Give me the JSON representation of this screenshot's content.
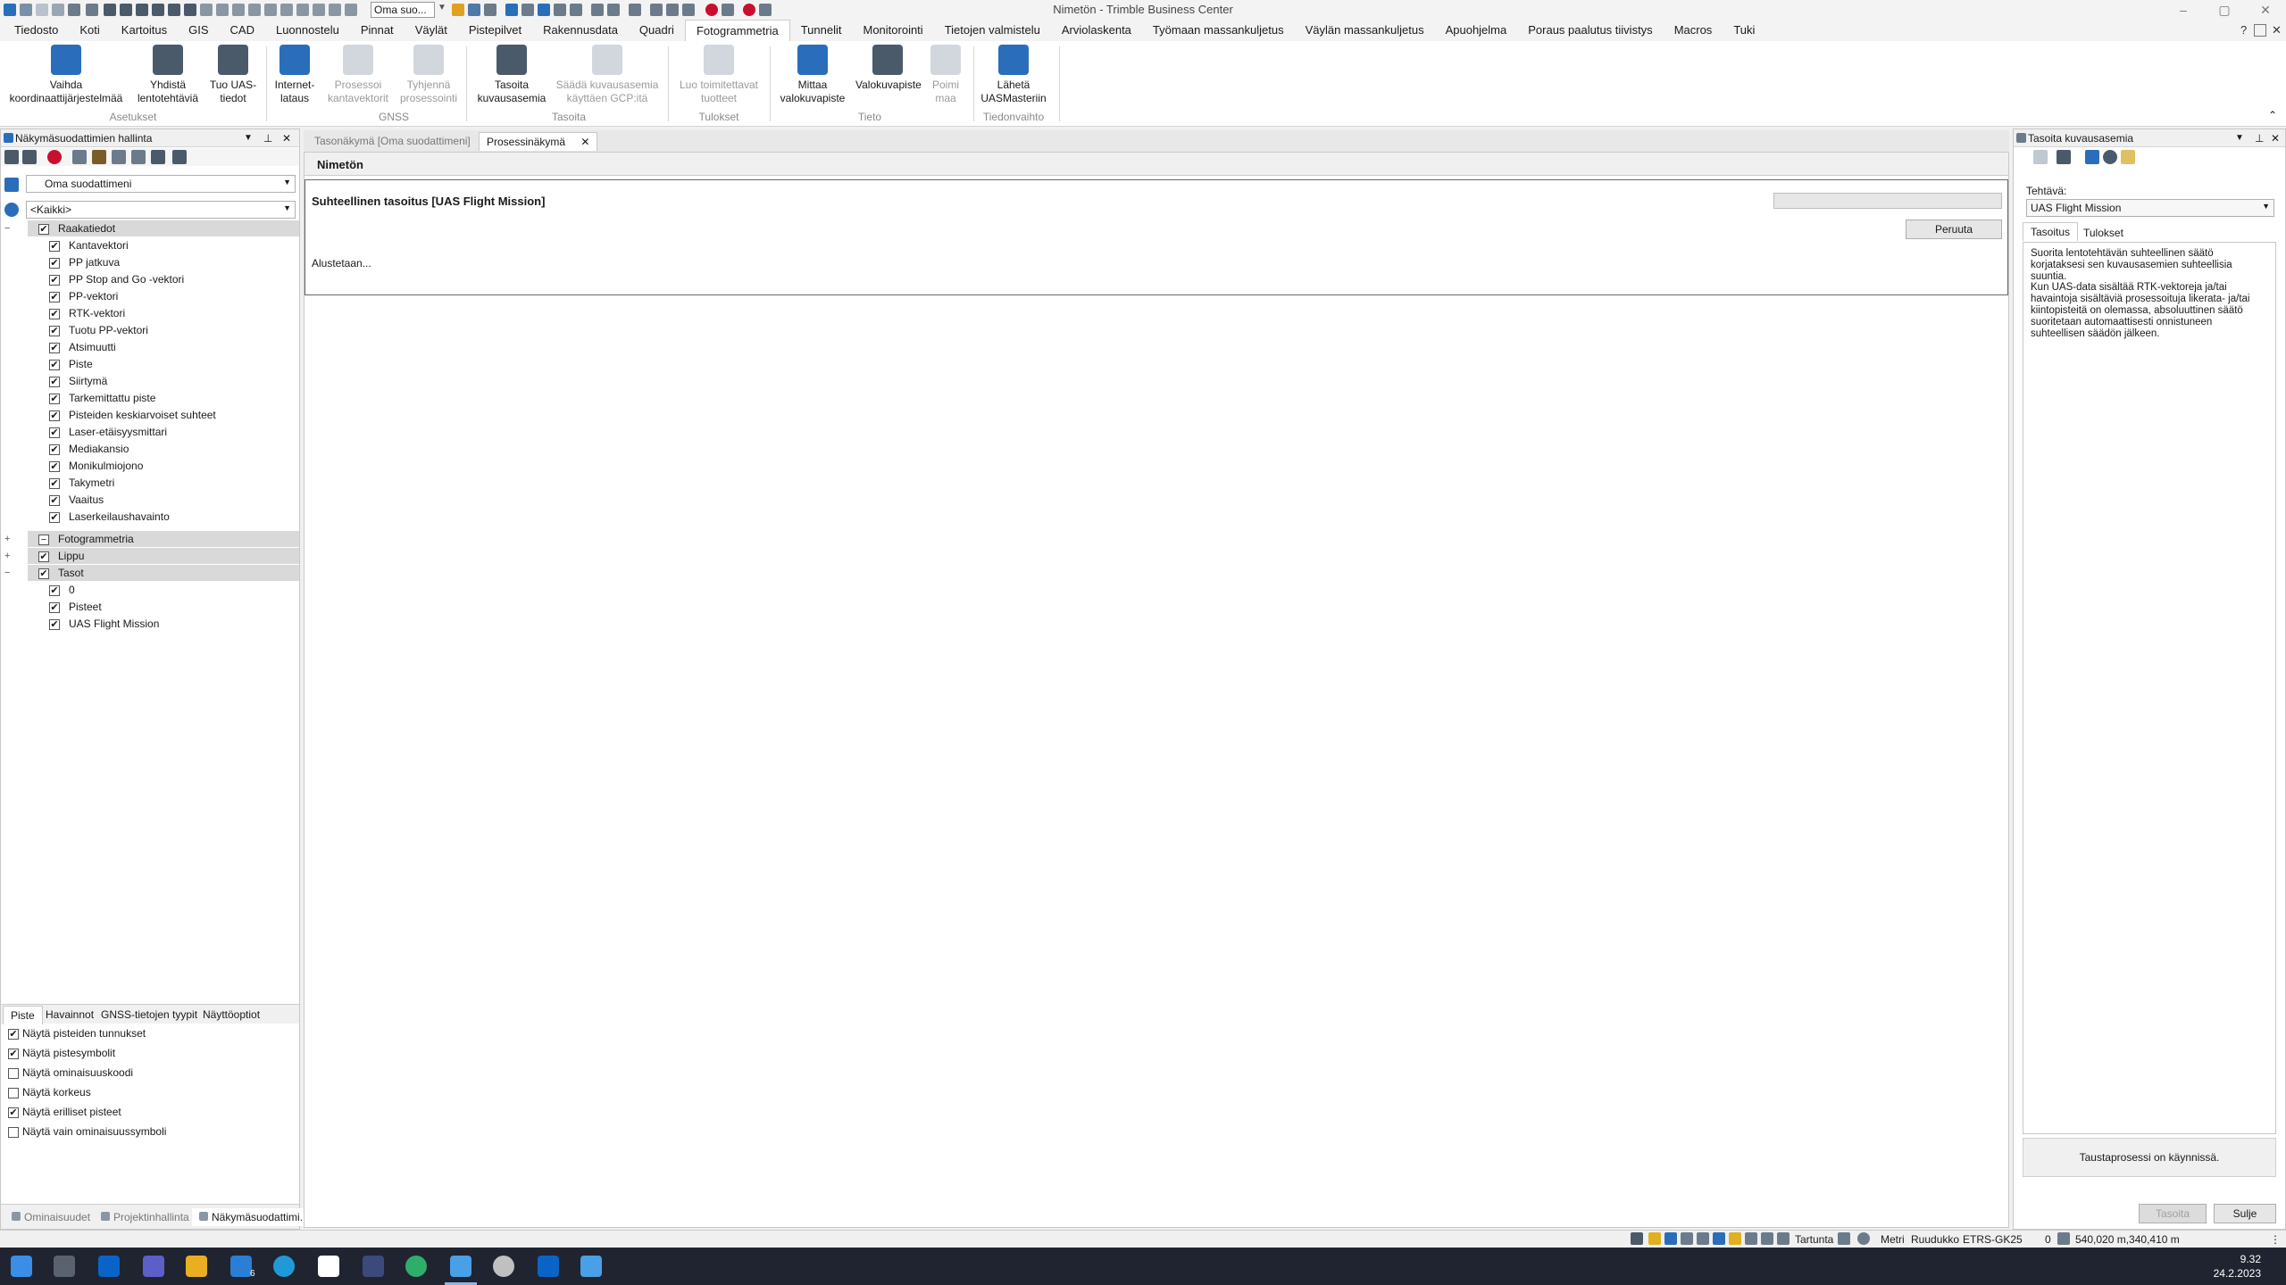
{
  "window": {
    "title": "Nimetön - Trimble Business Center"
  },
  "quick_access": {
    "filter_value": "Oma suo..."
  },
  "menu": [
    {
      "label": "Tiedosto"
    },
    {
      "label": "Koti"
    },
    {
      "label": "Kartoitus"
    },
    {
      "label": "GIS"
    },
    {
      "label": "CAD"
    },
    {
      "label": "Luonnostelu"
    },
    {
      "label": "Pinnat"
    },
    {
      "label": "Väylät"
    },
    {
      "label": "Pistepilvet"
    },
    {
      "label": "Rakennusdata"
    },
    {
      "label": "Quadri"
    },
    {
      "label": "Fotogrammetria"
    },
    {
      "label": "Tunnelit"
    },
    {
      "label": "Monitorointi"
    },
    {
      "label": "Tietojen valmistelu"
    },
    {
      "label": "Arviolaskenta"
    },
    {
      "label": "Työmaan massankuljetus"
    },
    {
      "label": "Väylän massankuljetus"
    },
    {
      "label": "Apuohjelma"
    },
    {
      "label": "Poraus paalutus tiivistys"
    },
    {
      "label": "Macros"
    },
    {
      "label": "Tuki"
    }
  ],
  "menu_help": "?",
  "ribbon": {
    "buttons": [
      {
        "label1": "Vaihda",
        "label2": "koordinaattijärjestelmää",
        "enabled": true,
        "icon": "globe-icon"
      },
      {
        "label1": "Yhdistä",
        "label2": "lentotehtäviä",
        "enabled": true,
        "icon": "drone-merge-icon"
      },
      {
        "label1": "Tuo UAS-",
        "label2": "tiedot",
        "enabled": true,
        "icon": "drone-import-icon"
      },
      {
        "label1": "Internet-",
        "label2": "lataus",
        "enabled": true,
        "icon": "cloud-download-icon"
      },
      {
        "label1": "Prosessoi",
        "label2": "kantavektorit",
        "enabled": false,
        "icon": "vector-process-icon"
      },
      {
        "label1": "Tyhjennä",
        "label2": "prosessointi",
        "enabled": false,
        "icon": "vector-clear-icon"
      },
      {
        "label1": "Tasoita",
        "label2": "kuvausasemia",
        "enabled": true,
        "icon": "network-adjust-icon"
      },
      {
        "label1": "Säädä kuvausasemia",
        "label2": "käyttäen GCP:itä",
        "enabled": false,
        "icon": "gcp-adjust-icon"
      },
      {
        "label1": "Luo toimitettavat",
        "label2": "tuotteet",
        "enabled": false,
        "icon": "deliverables-icon"
      },
      {
        "label1": "Mittaa",
        "label2": "valokuvapiste",
        "enabled": true,
        "icon": "measure-photo-point-icon"
      },
      {
        "label1": "Valokuvapiste",
        "label2": "",
        "enabled": true,
        "icon": "photo-point-icon"
      },
      {
        "label1": "Poimi",
        "label2": "maa",
        "enabled": false,
        "icon": "extract-ground-icon"
      },
      {
        "label1": "Lähetä",
        "label2": "UASMasteriin",
        "enabled": true,
        "icon": "send-uasmaster-icon"
      }
    ],
    "groups": [
      "Asetukset",
      "GNSS",
      "Tasoita",
      "Tulokset",
      "Tieto",
      "Tiedonvaihto"
    ]
  },
  "left_panel": {
    "title": "Näkymäsuodattimien hallinta",
    "filter_value": "Oma suodattimeni",
    "scope_value": "<Kaikki>",
    "tree": [
      {
        "label": "Raakatiedot",
        "group": true,
        "expander": "−",
        "check": "✔"
      },
      {
        "label": "Kantavektori",
        "check": "✔"
      },
      {
        "label": "PP jatkuva",
        "check": "✔"
      },
      {
        "label": "PP Stop and Go -vektori",
        "check": "✔"
      },
      {
        "label": "PP-vektori",
        "check": "✔"
      },
      {
        "label": "RTK-vektori",
        "check": "✔"
      },
      {
        "label": "Tuotu PP-vektori",
        "check": "✔"
      },
      {
        "label": "Atsimuutti",
        "check": "✔"
      },
      {
        "label": "Piste",
        "check": "✔"
      },
      {
        "label": "Siirtymä",
        "check": "✔"
      },
      {
        "label": "Tarkemittattu piste",
        "check": "✔"
      },
      {
        "label": "Pisteiden keskiarvoiset suhteet",
        "check": "✔"
      },
      {
        "label": "Laser-etäisyysmittari",
        "check": "✔"
      },
      {
        "label": "Mediakansio",
        "check": "✔"
      },
      {
        "label": "Monikulmiojono",
        "check": "✔"
      },
      {
        "label": "Takymetri",
        "check": "✔"
      },
      {
        "label": "Vaaitus",
        "check": "✔"
      },
      {
        "label": "Laserkeilaushavainto",
        "check": "✔"
      },
      {
        "label": "Fotogrammetria",
        "group": true,
        "expander": "+",
        "check": "−"
      },
      {
        "label": "Lippu",
        "group": true,
        "expander": "+",
        "check": "✔"
      },
      {
        "label": "Tasot",
        "group": true,
        "expander": "−",
        "check": "✔"
      },
      {
        "label": "0",
        "check": "✔"
      },
      {
        "label": "Pisteet",
        "check": "✔"
      },
      {
        "label": "UAS Flight Mission",
        "check": "✔"
      }
    ],
    "options_tabs": [
      "Piste",
      "Havainnot",
      "GNSS-tietojen tyypit",
      "Näyttöoptiot"
    ],
    "options": [
      {
        "label": "Näytä pisteiden tunnukset",
        "check": "✔"
      },
      {
        "label": "Näytä pistesymbolit",
        "check": "✔"
      },
      {
        "label": "Näytä ominaisuuskoodi",
        "check": ""
      },
      {
        "label": "Näytä korkeus",
        "check": ""
      },
      {
        "label": "Näytä erilliset pisteet",
        "check": "✔"
      },
      {
        "label": "Näytä vain ominaisuussymboli",
        "check": ""
      }
    ],
    "bottom_tabs": [
      "Ominaisuudet",
      "Projektinhallinta",
      "Näkymäsuodattimi..."
    ]
  },
  "doc_tabs": [
    {
      "label": "Tasonäkymä [Oma suodattimeni]",
      "active": false
    },
    {
      "label": "Prosessinäkymä",
      "active": true
    }
  ],
  "process_view": {
    "header": "Nimetön",
    "task_title": "Suhteellinen tasoitus [UAS Flight Mission]",
    "cancel_label": "Peruuta",
    "status": "Alustetaan..."
  },
  "right_panel": {
    "title": "Tasoita kuvausasemia",
    "task_label": "Tehtävä:",
    "task_value": "UAS Flight Mission",
    "tabs": [
      "Tasoitus",
      "Tulokset"
    ],
    "description1": "Suorita lentotehtävän suhteellinen säätö korjataksesi sen kuvausasemien suhteellisia suuntia.",
    "description2": "Kun UAS-data sisältää RTK-vektoreja ja/tai havaintoja sisältäviä prosessoituja likerata- ja/tai kiintopisteitä on olemassa, absoluuttinen säätö suoritetaan automaattisesti onnistuneen suhteellisen säädön jälkeen.",
    "status": "Taustaprosessi on käynnissä.",
    "apply_label": "Tasoita",
    "close_label": "Sulje"
  },
  "status_bar": {
    "snap": "Tartunta",
    "unit": "Metri",
    "grid": "Ruudukko",
    "crs": "ETRS-GK25",
    "count": "0",
    "coords": "540,020 m,340,410 m"
  },
  "taskbar": {
    "time": "9.32",
    "date": "24.2.2023",
    "badge": "6"
  }
}
